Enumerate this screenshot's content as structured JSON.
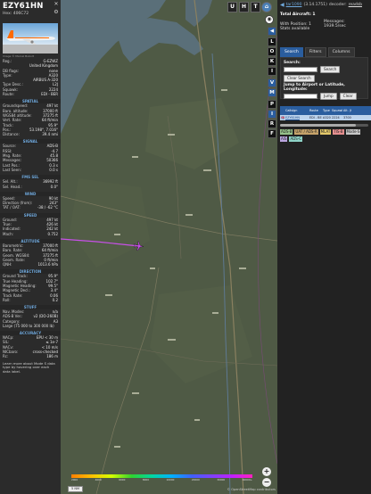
{
  "left": {
    "callsign": "EZY61HN",
    "hex_label": "Hex:",
    "hex": "406C72",
    "photo_credit": "Image © Marcel Bubolt",
    "info": [
      {
        "k": "Reg.:",
        "v": "G-EZWZ"
      },
      {
        "k": "",
        "v": "United Kingdom"
      },
      {
        "k": "DB flags:",
        "v": "none"
      },
      {
        "k": "Type:",
        "v": "A320"
      },
      {
        "k": "",
        "v": "AIRBUS A-320"
      },
      {
        "k": "Type Desc.:",
        "v": "L2J"
      },
      {
        "k": "Squawk:",
        "v": "2224"
      },
      {
        "k": "Route:",
        "v": "EDI - BER"
      }
    ],
    "sections": {
      "spatial": "SPATIAL",
      "signal": "SIGNAL",
      "fms": "FMS SEL",
      "wind": "WIND",
      "speed": "SPEED",
      "altitude": "ALTITUDE",
      "direction": "DIRECTION",
      "stuff": "STUFF",
      "accuracy": "ACCURACY"
    },
    "spatial": [
      {
        "k": "Groundspeed:",
        "v": "497 kt"
      },
      {
        "k": "Baro. altitude:",
        "v": "37000 ft"
      },
      {
        "k": "WGS84 altitude:",
        "v": "37275 ft"
      },
      {
        "k": "Vert. Rate:",
        "v": "64 ft/min"
      },
      {
        "k": "Track:",
        "v": "95.9°"
      },
      {
        "k": "Pos.:",
        "v": "53.198°, 7.016°"
      },
      {
        "k": "Distance:",
        "v": "39.4 nmi"
      }
    ],
    "signal": [
      {
        "k": "Source:",
        "v": "ADS-B"
      },
      {
        "k": "RSSI:",
        "v": "-4.7"
      },
      {
        "k": "Msg. Rate:",
        "v": "45.8"
      },
      {
        "k": "Messages:",
        "v": "50366"
      },
      {
        "k": "Last Pos.:",
        "v": "0.3 s"
      },
      {
        "k": "Last Seen:",
        "v": "0.0 s"
      }
    ],
    "fms": [
      {
        "k": "Sel. Alt.:",
        "v": "36992 ft"
      },
      {
        "k": "Sel. Head.:",
        "v": "0.0°"
      }
    ],
    "wind": [
      {
        "k": "Speed:",
        "v": "90 kt"
      },
      {
        "k": "Direction (from):",
        "v": "243°"
      },
      {
        "k": "TAT / OAT:",
        "v": "-38 / -62 °C"
      }
    ],
    "speed": [
      {
        "k": "Ground:",
        "v": "497 kt"
      },
      {
        "k": "True:",
        "v": "426 kt"
      },
      {
        "k": "Indicated:",
        "v": "242 kt"
      },
      {
        "k": "Mach:",
        "v": "0.752"
      }
    ],
    "altitude": [
      {
        "k": "Barometric:",
        "v": "37000 ft"
      },
      {
        "k": "Baro. Rate:",
        "v": "64 ft/min"
      },
      {
        "k": "Geom. WGS84:",
        "v": "37275 ft"
      },
      {
        "k": "Geom. Rate:",
        "v": "0 ft/min"
      },
      {
        "k": "QNH:",
        "v": "1013.6 hPa"
      }
    ],
    "direction": [
      {
        "k": "Ground Track:",
        "v": "95.9°"
      },
      {
        "k": "True Heading:",
        "v": "102.7°"
      },
      {
        "k": "Magnetic Heading:",
        "v": "99.5°"
      },
      {
        "k": "Magnetic Decl.:",
        "v": "3.4°"
      },
      {
        "k": "Track Rate:",
        "v": "0.06"
      },
      {
        "k": "Roll:",
        "v": "0.2"
      }
    ],
    "stuff": [
      {
        "k": "Nav. Modes:",
        "v": "n/a"
      },
      {
        "k": "ADS-B Ver.:",
        "v": "v2 (DO-260B)"
      },
      {
        "k": "Category:",
        "v": "A3"
      }
    ],
    "category_desc": "Large (75 000 to 300 000 lb)",
    "accuracy": [
      {
        "k": "NACp:",
        "v": "EPU < 30 m"
      },
      {
        "k": "SIL:",
        "v": "≤ 1e-7"
      },
      {
        "k": "NACv:",
        "v": "< 10 m/s"
      },
      {
        "k": "NICbaro:",
        "v": "cross-checked"
      },
      {
        "k": "Rc:",
        "v": "186 m"
      }
    ],
    "footer": "Learn more about Mode S data type by hovering over each data label."
  },
  "map": {
    "top_buttons": [
      "U",
      "H",
      "T"
    ],
    "side_buttons": [
      "L",
      "O",
      "K",
      "I",
      "V",
      "M",
      "P",
      "I",
      "R",
      "F"
    ],
    "zoom_in": "+",
    "zoom_out": "−",
    "legend_labels": [
      "2000",
      "4000",
      "6000",
      "8000",
      "10000",
      "20000",
      "30000",
      "40000+"
    ],
    "scale": "5 NM",
    "attribution": "© OpenStreetMap contributors",
    "aircraft_label": "EZY61HN"
  },
  "right": {
    "version_link": "tar1090",
    "version": "(3.14.1751)",
    "decoder_text": "decoder:",
    "decoder_link": "readsb",
    "stats": {
      "total_label": "Total Aircraft:",
      "total_value": "1",
      "position_label": "With Position:",
      "position_value": "1",
      "available": "Stats available",
      "messages_label": "Messages:",
      "messages_value": "1939.5/sec"
    },
    "tabs": [
      "Search",
      "Filters",
      "Columns"
    ],
    "search_label": "Search:",
    "search_button": "Search",
    "clear_search": "Clear Search",
    "jump_label": "Jump to Airport or Latitude, Longitude:",
    "jump_button": "Jump",
    "clear_button": "Clear",
    "table": {
      "headers": [
        "",
        "Callsign",
        "Route",
        "Type",
        "Squawk",
        "Alt. (ft)"
      ],
      "rows": [
        [
          "🇬🇧",
          "EZY61HN",
          "EDI - BER",
          "A320",
          "2224",
          "37000"
        ]
      ]
    },
    "badges": [
      {
        "label": "ADS-B",
        "color": "#96c18a"
      },
      {
        "label": "UAT / ADS-R",
        "color": "#c6a36a"
      },
      {
        "label": "MLAT",
        "color": "#e3c86a"
      },
      {
        "label": "TIS-B",
        "color": "#e58f8f"
      },
      {
        "label": "Mode-S",
        "color": "#c8c8c8"
      },
      {
        "label": "AIS",
        "color": "#bba6e0"
      },
      {
        "label": "ADS-C",
        "color": "#8fd4c8"
      }
    ]
  },
  "colors": {
    "accent": "#2a5d9e",
    "section": "#6fa8dc",
    "map_land": "#4f5a45",
    "map_water": "#5a6f79"
  }
}
